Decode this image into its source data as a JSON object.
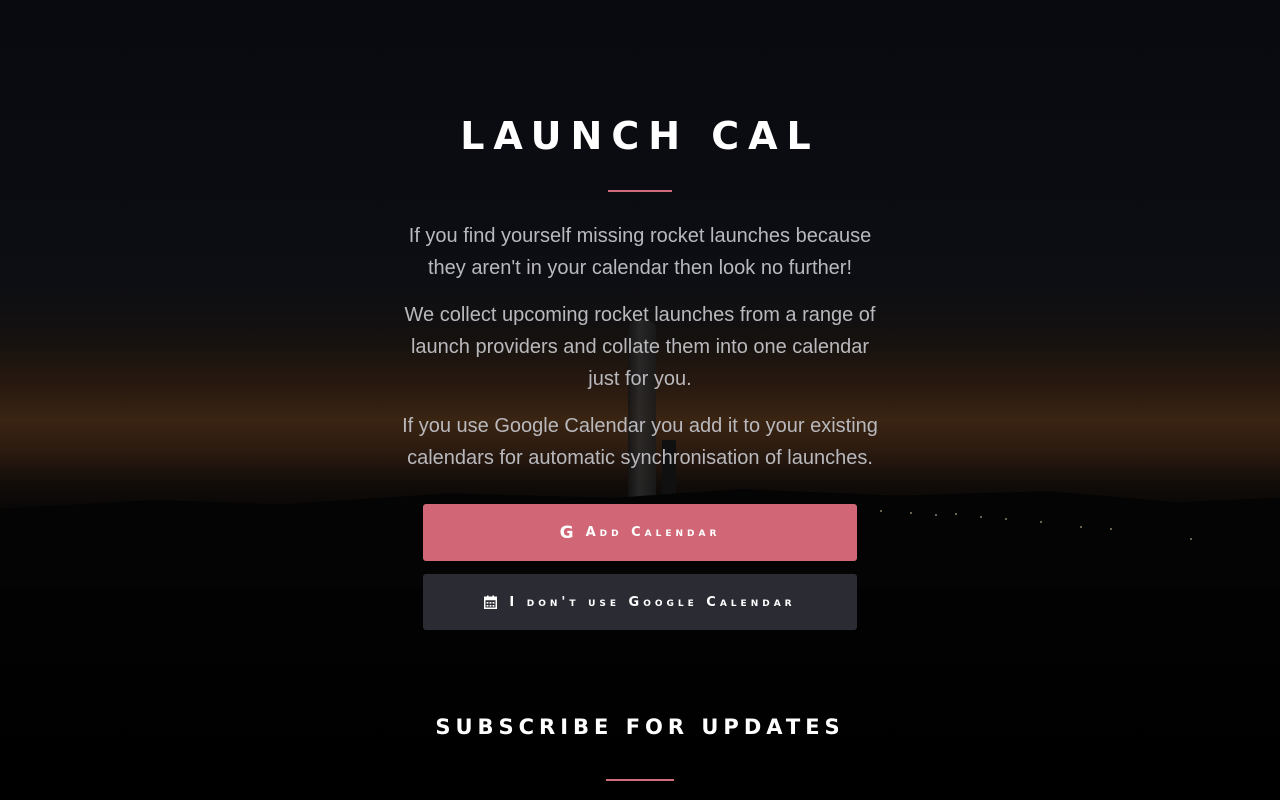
{
  "header": {
    "title": "LAUNCH CAL"
  },
  "intro": {
    "paragraphs": [
      "If you find yourself missing rocket launches because they aren't in your calendar then look no further!",
      "We collect upcoming rocket launches from a range of launch providers and collate them into one calendar just for you.",
      "If you use Google Calendar you add it to your existing calendars for automatic synchronisation of launches."
    ]
  },
  "actions": {
    "add_calendar": {
      "icon": "google-icon",
      "icon_glyph": "G",
      "label": "Add Calendar"
    },
    "no_google": {
      "icon": "calendar-icon",
      "label": "I don't use Google Calendar"
    }
  },
  "subscribe": {
    "title": "SUBSCRIBE FOR UPDATES"
  },
  "colors": {
    "accent": "#d16676",
    "divider": "#d16d7a",
    "secondary_button": "#2b2b34",
    "body_text": "#b8b8bd"
  }
}
